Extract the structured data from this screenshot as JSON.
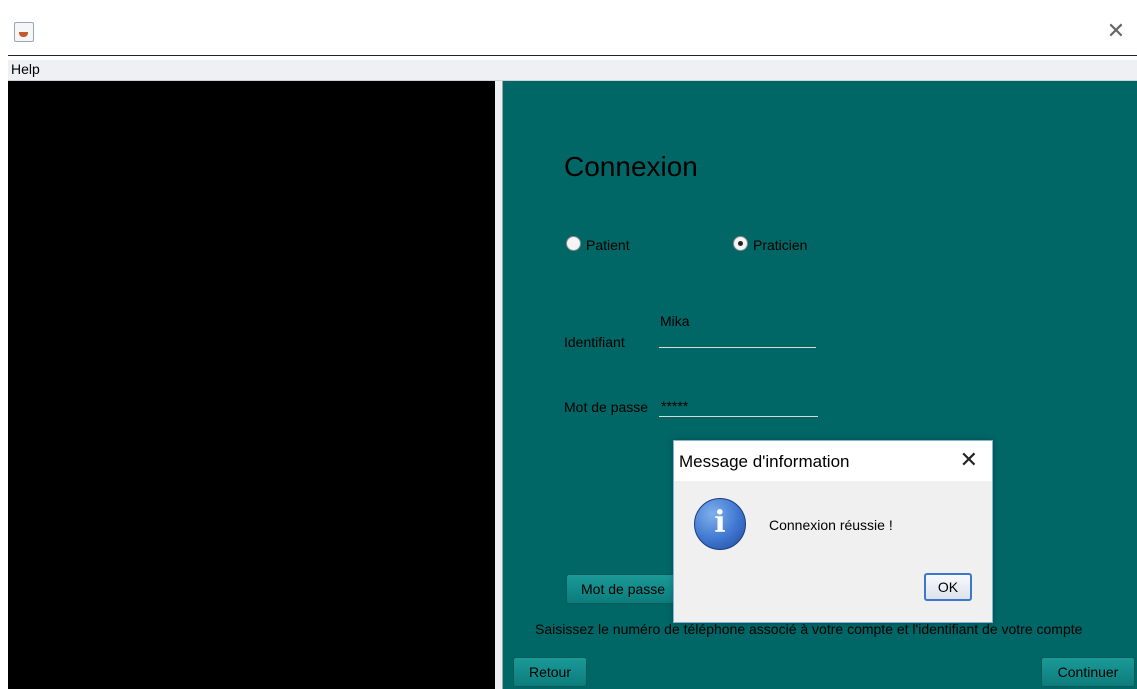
{
  "window": {
    "close_icon": "close-icon",
    "app_icon": "java-app-icon"
  },
  "menubar": {
    "help_label": "Help"
  },
  "login": {
    "heading": "Connexion",
    "radio_patient": "Patient",
    "radio_praticien": "Praticien",
    "selected_role": "Praticien",
    "identifiant_label": "Identifiant",
    "identifiant_value": "Mika",
    "password_label": "Mot de passe",
    "password_value": "*****",
    "forgot_button": "Mot de passe",
    "info_text": "Saisissez le numéro de téléphone associé à votre compte et l'identifiant de votre compte",
    "back_button": "Retour",
    "continue_button": "Continuer"
  },
  "dialog": {
    "title": "Message d'information",
    "message": "Connexion réussie !",
    "ok_label": "OK",
    "icon": "info-icon"
  },
  "colors": {
    "panel": "#006766",
    "accent_button": "#0c7c7b",
    "left_panel": "#000000"
  }
}
